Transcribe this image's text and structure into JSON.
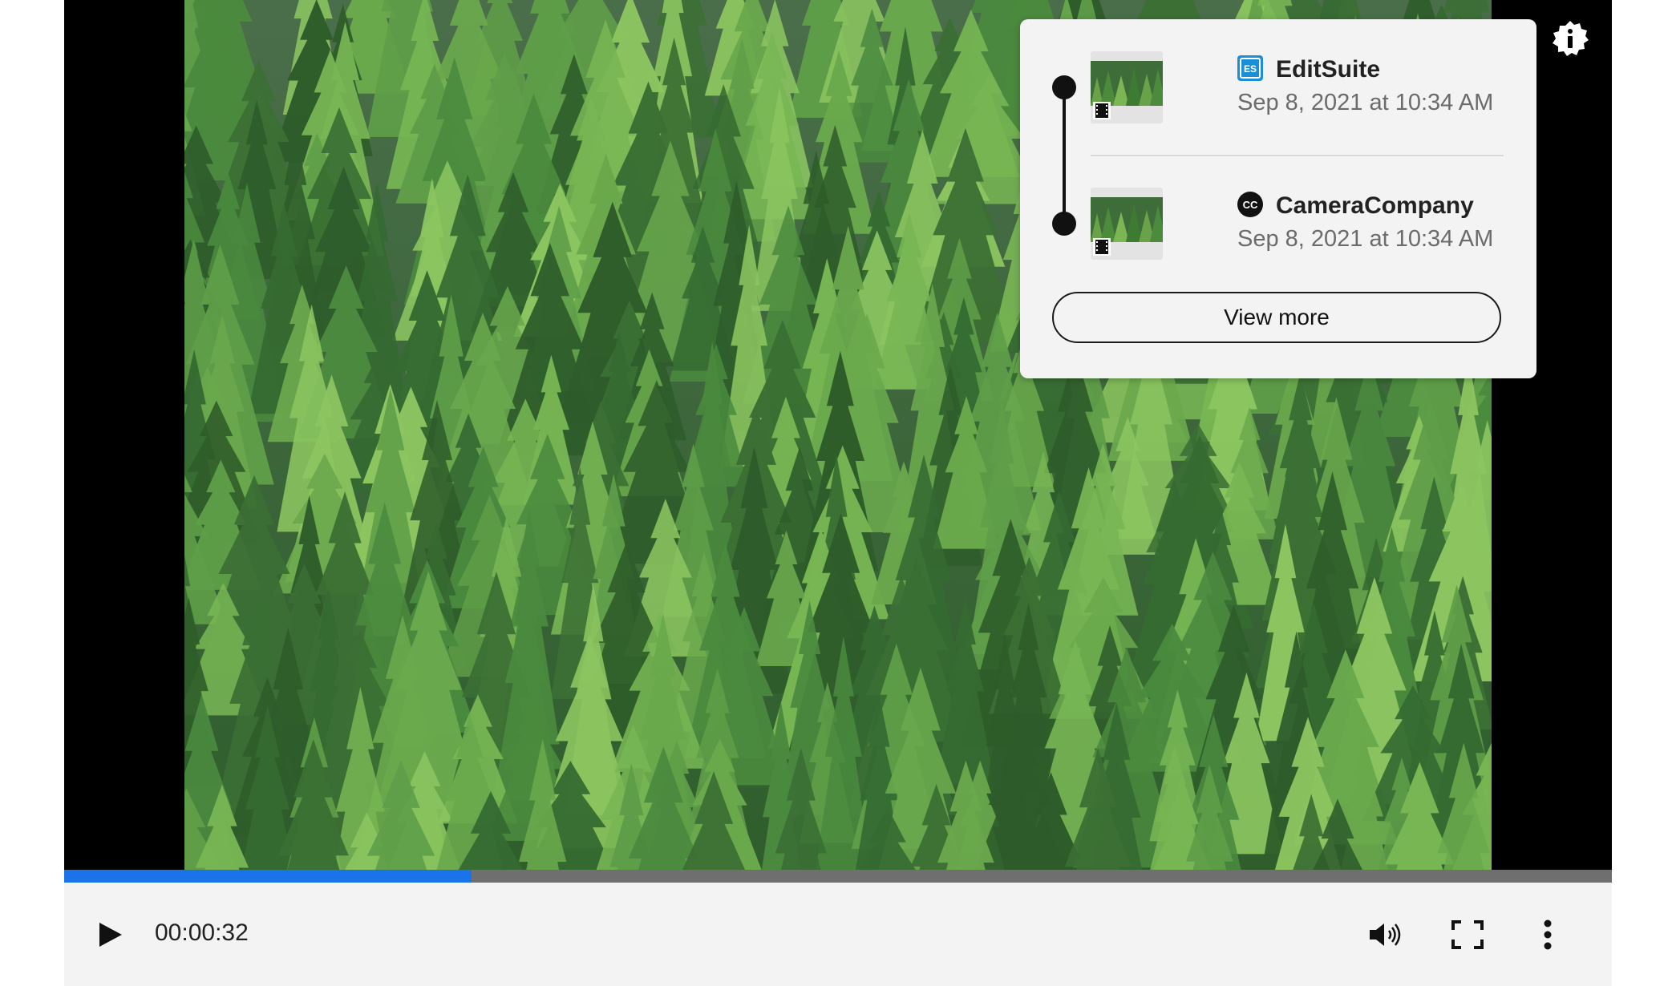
{
  "player": {
    "current_time": "00:00:32",
    "progress_fraction": 0.263,
    "accent_color": "#1a73e8",
    "track_color": "#6f6f6f",
    "video_subject": "aerial view of conifer forest"
  },
  "provenance_panel": {
    "entries": [
      {
        "app_name": "EditSuite",
        "logo_text": "ES",
        "logo_icon": "editsuite-logo-icon",
        "logo_color": "#1a8fd8",
        "date": "Sep 8, 2021 at 10:34 AM",
        "thumbnail_icon": "film-icon"
      },
      {
        "app_name": "CameraCompany",
        "logo_text": "CC",
        "logo_icon": "cameracompany-logo-icon",
        "logo_color": "#111111",
        "date": "Sep 8, 2021 at 10:34 AM",
        "thumbnail_icon": "film-icon"
      }
    ],
    "view_more_label": "View more"
  },
  "icons": {
    "info": "info-badge-icon",
    "play": "play-icon",
    "volume": "volume-icon",
    "fullscreen": "fullscreen-icon",
    "more": "more-vertical-icon"
  }
}
